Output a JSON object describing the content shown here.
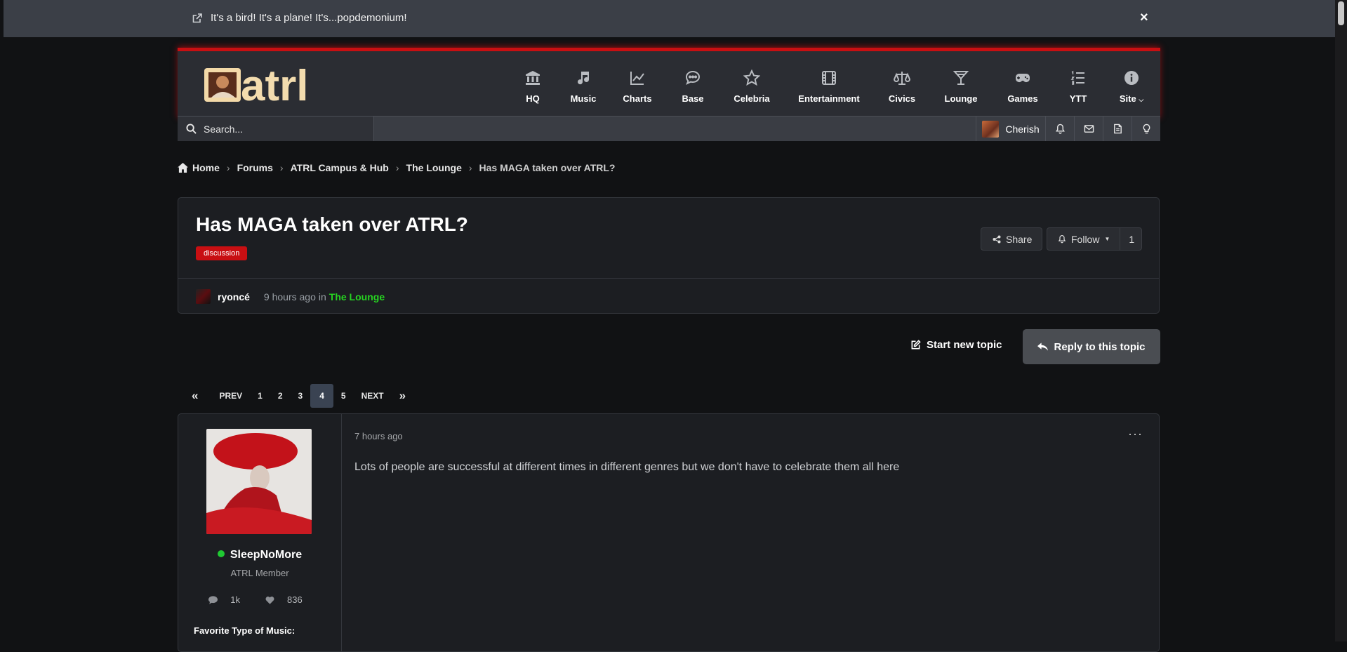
{
  "announcement": {
    "text": "It's a bird! It's a plane! It's...popdemonium!",
    "close": "×"
  },
  "logo": {
    "text": "atrl"
  },
  "nav": [
    {
      "label": "HQ",
      "icon": "bank-icon"
    },
    {
      "label": "Music",
      "icon": "music-note-icon"
    },
    {
      "label": "Charts",
      "icon": "line-chart-icon"
    },
    {
      "label": "Base",
      "icon": "chat-bubble-icon"
    },
    {
      "label": "Celebria",
      "icon": "star-icon"
    },
    {
      "label": "Entertainment",
      "icon": "film-icon"
    },
    {
      "label": "Civics",
      "icon": "scales-icon"
    },
    {
      "label": "Lounge",
      "icon": "cocktail-icon"
    },
    {
      "label": "Games",
      "icon": "gamepad-icon"
    },
    {
      "label": "YTT",
      "icon": "list-icon"
    },
    {
      "label": "Site",
      "icon": "info-icon"
    }
  ],
  "search": {
    "placeholder": "Search..."
  },
  "user": {
    "name": "Cherish"
  },
  "breadcrumb": [
    "Home",
    "Forums",
    "ATRL Campus & Hub",
    "The Lounge",
    "Has MAGA taken over ATRL?"
  ],
  "topic": {
    "title": "Has MAGA taken over ATRL?",
    "tag": "discussion",
    "share": "Share",
    "follow": "Follow",
    "follow_count": "1",
    "author": "ryoncé",
    "time": "9 hours ago",
    "in_word": "in",
    "forum": "The Lounge"
  },
  "actions": {
    "start_topic": "Start new topic",
    "reply": "Reply to this topic"
  },
  "pagination": {
    "prev": "PREV",
    "next": "NEXT",
    "pages": [
      "1",
      "2",
      "3",
      "4",
      "5"
    ],
    "current": "4"
  },
  "post": {
    "author": "SleepNoMore",
    "role": "ATRL Member",
    "posts": "1k",
    "likes": "836",
    "favorite_label": "Favorite Type of Music:",
    "time": "7 hours ago",
    "body": "Lots of people are successful at different times in different genres but we don't have to celebrate them all here"
  },
  "colors": {
    "accent": "#c80f12",
    "forum_link": "#26d321",
    "online": "#20c933"
  }
}
